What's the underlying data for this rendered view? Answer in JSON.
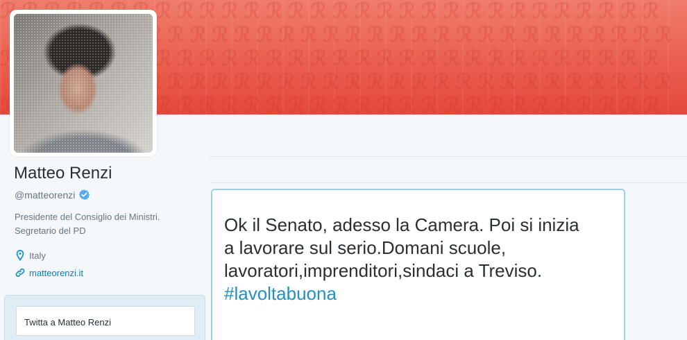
{
  "colors": {
    "banner": "#ea5f4e",
    "link": "#0084b4",
    "hashtag": "#1f8fc4",
    "verified": "#55acee"
  },
  "profile": {
    "name": "Matteo Renzi",
    "handle": "@matteorenzi",
    "verified_icon": "verified-badge-icon",
    "bio_lines": [
      "Presidente del Consiglio dei Ministri.",
      "Segretario del PD"
    ],
    "location": "Italy",
    "location_icon": "location-pin-icon",
    "website": "matteorenzi.it",
    "website_icon": "link-icon"
  },
  "tweet_box": {
    "placeholder": "Twitta a Matteo Renzi"
  },
  "tweet": {
    "lines": [
      "Ok il Senato, adesso la Camera. Poi si inizia",
      "a lavorare sul serio.Domani scuole,",
      "lavoratori,imprenditori,sindaci a Treviso."
    ],
    "hashtag": "#lavoltabuona"
  }
}
